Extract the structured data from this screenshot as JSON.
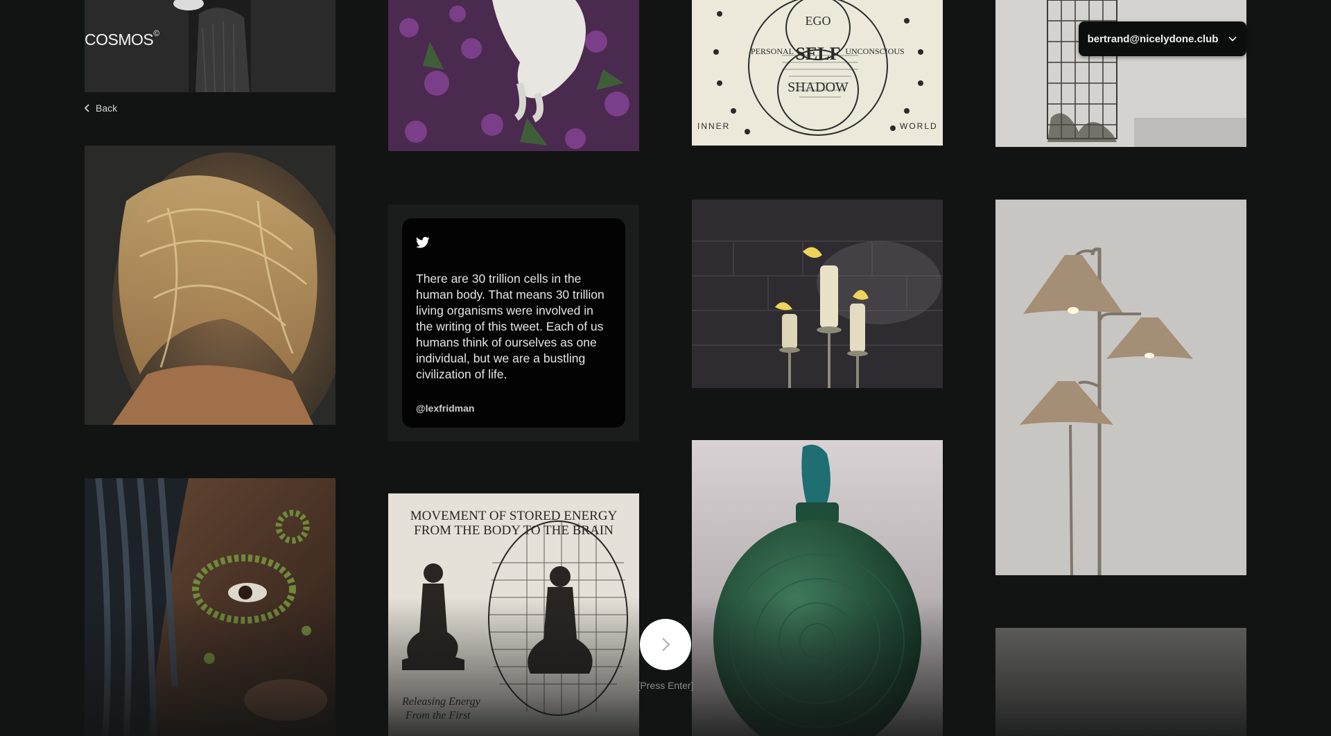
{
  "app": {
    "logo": "COSMOS",
    "logo_mark": "©"
  },
  "nav": {
    "back_label": "Back"
  },
  "account": {
    "email": "bertrand@nicelydone.club"
  },
  "tweet": {
    "text": "There are 30 trillion cells in the human body. That means 30 trillion living organisms were involved in the writing of this tweet. Each of us humans think of ourselves as one individual, but we are a bustling civilization of life.",
    "handle": "@lexfridman"
  },
  "diagram_psyche": {
    "ego": "EGO",
    "self": "SELF",
    "shadow": "SHADOW",
    "personal": "PERSONAL",
    "unconscious": "UNCONSCIOUS",
    "inner": "INNER",
    "world": "WORLD"
  },
  "book_page": {
    "title_line1": "MOVEMENT OF STORED ENERGY",
    "title_line2": "FROM THE BODY TO THE BRAIN",
    "caption_line1": "Releasing Energy",
    "caption_line2": "From the First"
  },
  "pager": {
    "hint": "[Press Enter]"
  },
  "colors": {
    "background": "#121414",
    "card": "#030303",
    "accent": "#ffffff"
  }
}
